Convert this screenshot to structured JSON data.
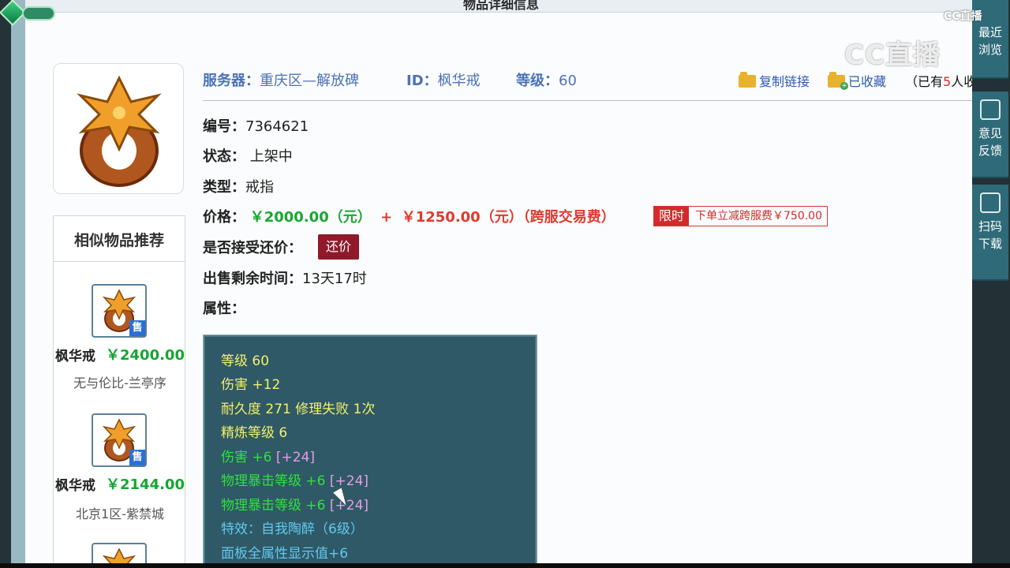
{
  "page": {
    "title": "物品详细信息"
  },
  "meta": {
    "server_label": "服务器：",
    "server_value": "重庆区—解放碑",
    "id_label": "ID：",
    "id_value": "枫华戒",
    "level_label": "等级：",
    "level_value": "60",
    "copy_link": "复制链接",
    "collected": "已收藏",
    "collected_count_prefix": "（已有",
    "collected_count_num": "5",
    "collected_count_suffix": "人收藏）"
  },
  "details": {
    "serial_label": "编号：",
    "serial_value": "7364621",
    "status_label": "状态：",
    "status_value": "上架中",
    "type_label": "类型：",
    "type_value": "戒指",
    "price_label": "价格：",
    "price_main": "￥2000.00（元）",
    "price_plus": "+",
    "price_fee": "￥1250.00（元）（跨服交易费）",
    "limit_tag": "限时",
    "limit_text": "下单立减跨服费￥750.00",
    "bargain_label": "是否接受还价：",
    "bargain_button": "还价",
    "remaining_label": "出售剩余时间：",
    "remaining_value": "13天17时",
    "attributes_label": "属性："
  },
  "attributes": [
    {
      "text": "等级 60",
      "color": "yellow"
    },
    {
      "text": "伤害 +12",
      "color": "yellow"
    },
    {
      "text": "耐久度 271 修理失败 1次",
      "color": "yellow"
    },
    {
      "text": "精炼等级 6",
      "color": "yellow"
    },
    {
      "text": "伤害 +6",
      "extra": "[+24]",
      "color": "green"
    },
    {
      "text": "物理暴击等级 +6",
      "extra": "[+24]",
      "color": "green"
    },
    {
      "text": "物理暴击等级 +6",
      "extra": "[+24]",
      "color": "green"
    },
    {
      "text": "特效：自我陶醉（6级）",
      "color": "cyan"
    },
    {
      "text": "面板全属性显示值+6",
      "color": "cyan"
    }
  ],
  "similar": {
    "title": "相似物品推荐",
    "items": [
      {
        "name": "枫华戒",
        "price": "￥2400.00",
        "server": "无与伦比-兰亭序",
        "badge": "售"
      },
      {
        "name": "枫华戒",
        "price": "￥2144.00",
        "server": "北京1区-紫禁城",
        "badge": "售"
      }
    ]
  },
  "rail": {
    "recent": "最近浏览",
    "feedback": "意见反馈",
    "scan": "扫码下载"
  },
  "watermark": {
    "big": "CC直播",
    "small": "CC直播"
  },
  "colors": {
    "accent_blue": "#4a72b8",
    "price_green": "#19a832",
    "price_red": "#e03a2e",
    "attr_bg": "#2f5966"
  }
}
